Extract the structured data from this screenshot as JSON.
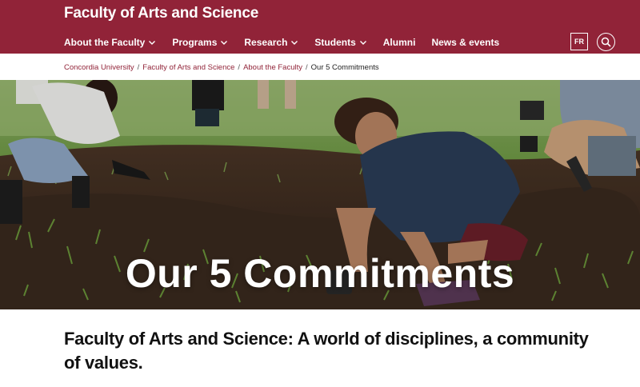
{
  "header": {
    "site_title": "Faculty of Arts and Science",
    "brand_color": "#912338",
    "nav": [
      {
        "label": "About the Faculty",
        "dropdown": true
      },
      {
        "label": "Programs",
        "dropdown": true
      },
      {
        "label": "Research",
        "dropdown": true
      },
      {
        "label": "Students",
        "dropdown": true
      },
      {
        "label": "Alumni",
        "dropdown": false
      },
      {
        "label": "News & events",
        "dropdown": false
      }
    ],
    "lang_button": "FR",
    "search_icon": "search-icon"
  },
  "breadcrumb": {
    "items": [
      "Concordia University",
      "Faculty of Arts and Science",
      "About the Faculty"
    ],
    "separator": "/",
    "current": "Our 5 Commitments"
  },
  "hero": {
    "title": "Our 5 Commitments",
    "image": "people-planting-grass-in-soil-photo"
  },
  "intro": {
    "heading": "Faculty of Arts and Science: A world of disciplines, a community of values."
  }
}
